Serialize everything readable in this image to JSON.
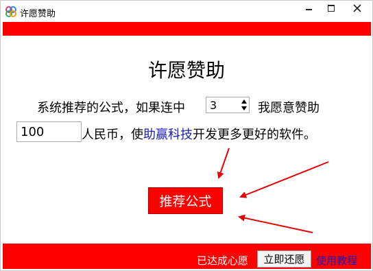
{
  "window": {
    "title": "许愿赞助"
  },
  "main": {
    "heading": "许愿赞助",
    "sentence_part1": "系统推荐的公式，如果连中",
    "periods_value": "3",
    "sentence_part2": "期，我愿意赞助",
    "amount_value": "100",
    "sentence_part3": "人民币，使",
    "brand": "助赢科技",
    "sentence_part4": "开发更多更好的软件。",
    "recommend_button": "推荐公式"
  },
  "footer": {
    "achieved_text": "已达成心愿",
    "repay_button": "立即还愿",
    "tutorial_link": "使用教程"
  },
  "colors": {
    "banner": "#ff0000",
    "brand_text": "#1b1bb8",
    "arrow": "#e60000"
  },
  "icons": [
    "app-icon",
    "minimize-icon",
    "maximize-icon",
    "close-icon",
    "spin-up-icon",
    "spin-down-icon"
  ]
}
